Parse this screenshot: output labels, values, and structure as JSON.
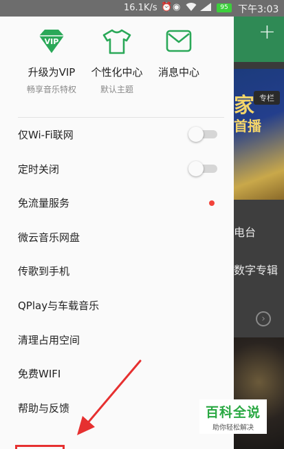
{
  "status_bar": {
    "speed": "16.1K/s",
    "battery": "95",
    "time": "下午3:03"
  },
  "features": [
    {
      "label": "升级为VIP",
      "sub": "畅享音乐特权",
      "icon": "vip-diamond-icon"
    },
    {
      "label": "个性化中心",
      "sub": "默认主题",
      "icon": "tshirt-icon"
    },
    {
      "label": "消息中心",
      "sub": "",
      "icon": "mail-icon"
    }
  ],
  "menu": [
    {
      "label": "仅Wi-Fi联网",
      "control": "toggle",
      "on": false
    },
    {
      "label": "定时关闭",
      "control": "toggle",
      "on": false
    },
    {
      "label": "免流量服务",
      "control": "dot"
    },
    {
      "label": "微云音乐网盘"
    },
    {
      "label": "传歌到手机"
    },
    {
      "label": "QPlay与车载音乐"
    },
    {
      "label": "清理占用空间"
    },
    {
      "label": "免费WIFI"
    },
    {
      "label": "帮助与反馈"
    }
  ],
  "background": {
    "badge": "专栏",
    "big1": "家",
    "big2": "首播",
    "item1": "电台",
    "item2": "数字专辑"
  },
  "watermark": {
    "title": "百科全说",
    "sub": "助你轻松解决"
  },
  "colors": {
    "accent_green": "#2aa858",
    "notify_red": "#f2433a",
    "annotation_red": "#e63030"
  }
}
